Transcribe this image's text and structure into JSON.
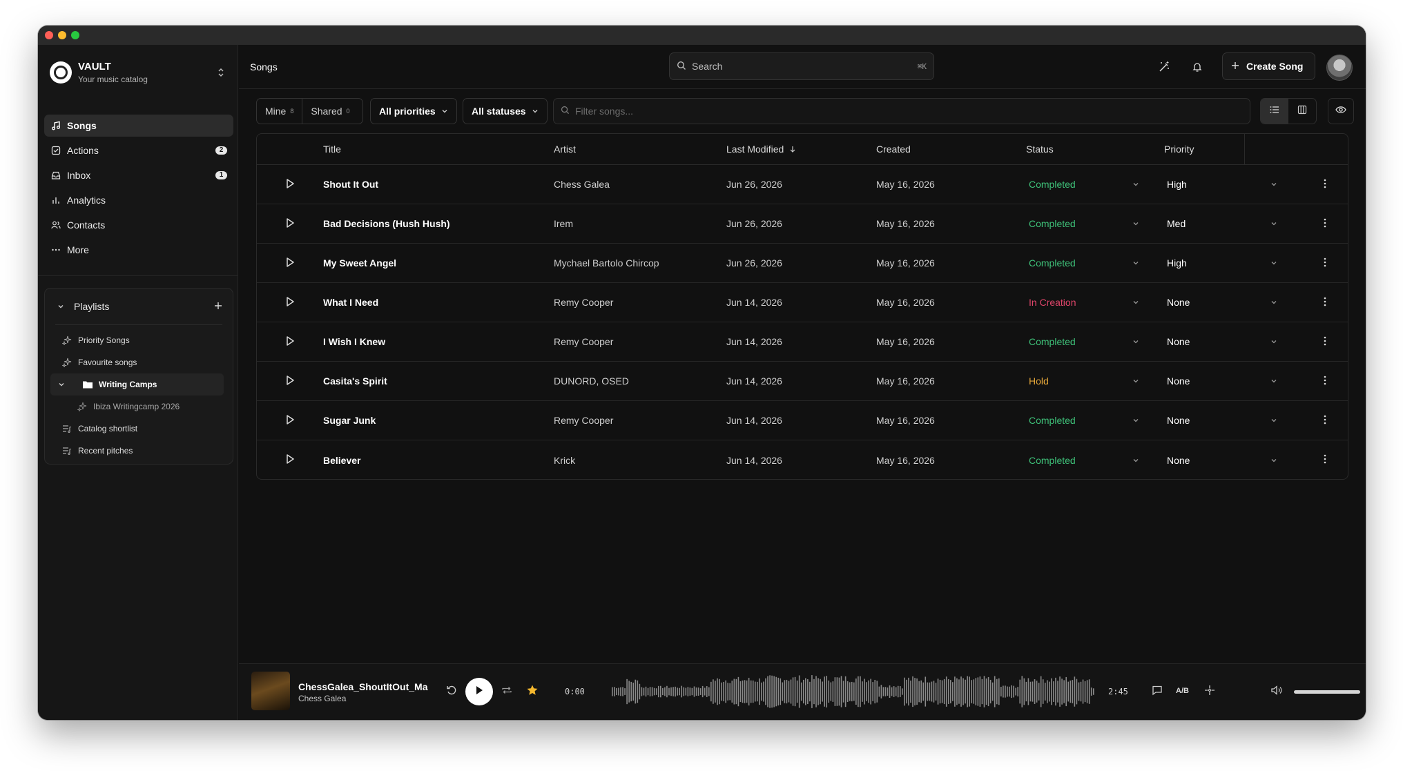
{
  "workspace": {
    "name": "VAULT",
    "subtitle": "Your music catalog"
  },
  "nav": [
    {
      "label": "Songs",
      "icon": "music-note-icon",
      "active": true,
      "badge": ""
    },
    {
      "label": "Actions",
      "icon": "checkbox-icon",
      "active": false,
      "badge": "2"
    },
    {
      "label": "Inbox",
      "icon": "inbox-icon",
      "active": false,
      "badge": "1"
    },
    {
      "label": "Analytics",
      "icon": "bar-chart-icon",
      "active": false,
      "badge": ""
    },
    {
      "label": "Contacts",
      "icon": "users-icon",
      "active": false,
      "badge": ""
    },
    {
      "label": "More",
      "icon": "ellipsis-icon",
      "active": false,
      "badge": ""
    }
  ],
  "playlists": {
    "title": "Playlists",
    "items": [
      {
        "label": "Priority Songs",
        "icon": "sparkles-icon",
        "kind": "item"
      },
      {
        "label": "Favourite songs",
        "icon": "sparkles-icon",
        "kind": "item"
      },
      {
        "label": "Writing Camps",
        "icon": "folder-icon",
        "kind": "folder"
      },
      {
        "label": "Ibiza Writingcamp 2026",
        "icon": "sparkles-icon",
        "kind": "sub"
      },
      {
        "label": "Catalog shortlist",
        "icon": "list-music-icon",
        "kind": "item"
      },
      {
        "label": "Recent pitches",
        "icon": "list-music-icon",
        "kind": "item"
      }
    ]
  },
  "header": {
    "title": "Songs",
    "search_label": "Search",
    "search_shortcut": "⌘K",
    "create_label": "Create Song"
  },
  "filters": {
    "mine_label": "Mine",
    "mine_count": "8",
    "shared_label": "Shared",
    "shared_count": "0",
    "priorities_label": "All priorities",
    "statuses_label": "All statuses",
    "filter_placeholder": "Filter songs..."
  },
  "table": {
    "columns": {
      "title": "Title",
      "artist": "Artist",
      "modified": "Last Modified",
      "created": "Created",
      "status": "Status",
      "priority": "Priority"
    },
    "rows": [
      {
        "title": "Shout It Out",
        "artist": "Chess Galea",
        "modified": "Jun 26, 2026",
        "created": "May 16, 2026",
        "status": "Completed",
        "priority": "High"
      },
      {
        "title": "Bad Decisions (Hush Hush)",
        "artist": "Irem",
        "modified": "Jun 26, 2026",
        "created": "May 16, 2026",
        "status": "Completed",
        "priority": "Med"
      },
      {
        "title": "My Sweet Angel",
        "artist": "Mychael Bartolo Chircop",
        "modified": "Jun 26, 2026",
        "created": "May 16, 2026",
        "status": "Completed",
        "priority": "High"
      },
      {
        "title": "What I Need",
        "artist": "Remy Cooper",
        "modified": "Jun 14, 2026",
        "created": "May 16, 2026",
        "status": "In Creation",
        "priority": "None"
      },
      {
        "title": "I Wish I Knew",
        "artist": "Remy Cooper",
        "modified": "Jun 14, 2026",
        "created": "May 16, 2026",
        "status": "Completed",
        "priority": "None"
      },
      {
        "title": "Casita's Spirit",
        "artist": "DUNORD, OSED",
        "modified": "Jun 14, 2026",
        "created": "May 16, 2026",
        "status": "Hold",
        "priority": "None"
      },
      {
        "title": "Sugar Junk",
        "artist": "Remy Cooper",
        "modified": "Jun 14, 2026",
        "created": "May 16, 2026",
        "status": "Completed",
        "priority": "None"
      },
      {
        "title": "Believer",
        "artist": "Krick",
        "modified": "Jun 14, 2026",
        "created": "May 16, 2026",
        "status": "Completed",
        "priority": "None"
      }
    ]
  },
  "player": {
    "track_name": "ChessGalea_ShoutItOut_Ma",
    "artist": "Chess Galea",
    "current_time": "0:00",
    "duration": "2:45",
    "ab_label": "A/B",
    "progress": 0,
    "volume": 1.0
  },
  "colors": {
    "status_completed": "#3fc37a",
    "status_in_creation": "#e2466b",
    "status_hold": "#e8a93a",
    "favorite_star": "#f5b82e"
  }
}
